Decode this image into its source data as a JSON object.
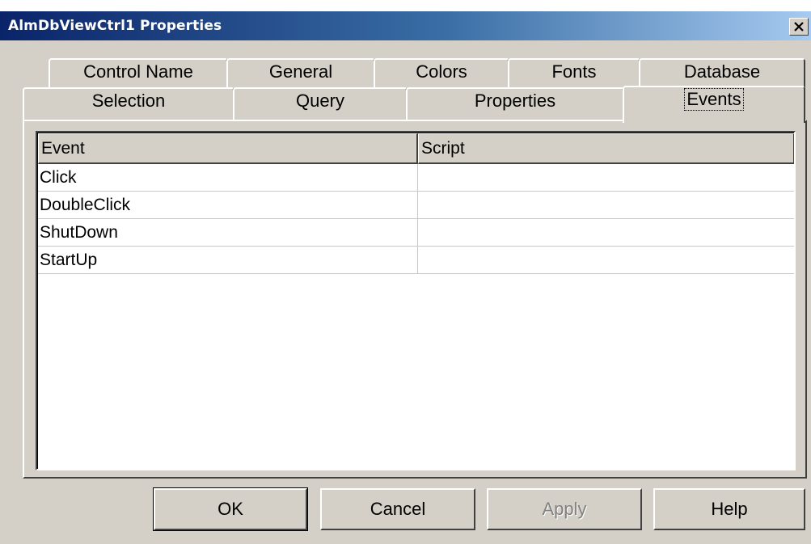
{
  "window": {
    "title": "AlmDbViewCtrl1 Properties"
  },
  "tabs": {
    "row_back": [
      {
        "id": "control-name",
        "label": "Control Name"
      },
      {
        "id": "general",
        "label": "General"
      },
      {
        "id": "colors",
        "label": "Colors"
      },
      {
        "id": "fonts",
        "label": "Fonts"
      },
      {
        "id": "database",
        "label": "Database"
      }
    ],
    "row_front": [
      {
        "id": "selection",
        "label": "Selection"
      },
      {
        "id": "query",
        "label": "Query"
      },
      {
        "id": "properties",
        "label": "Properties"
      },
      {
        "id": "events",
        "label": "Events",
        "selected": true
      }
    ]
  },
  "grid": {
    "columns": [
      "Event",
      "Script"
    ],
    "rows": [
      [
        "Click",
        ""
      ],
      [
        "DoubleClick",
        ""
      ],
      [
        "ShutDown",
        ""
      ],
      [
        "StartUp",
        ""
      ]
    ]
  },
  "buttons": {
    "ok": "OK",
    "cancel": "Cancel",
    "apply": "Apply",
    "help": "Help"
  },
  "colors": {
    "face": "#d4d0c8",
    "title_start": "#0a246a",
    "title_end": "#a6caf0"
  }
}
